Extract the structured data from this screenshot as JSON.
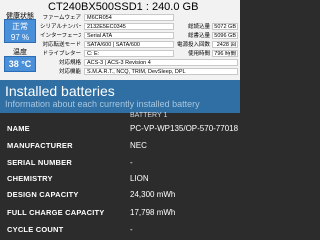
{
  "disk": {
    "title": "CT240BX500SSD1 : 240.0 GB",
    "health_label": "健康状態",
    "health_status": "正常",
    "health_percent": "97 %",
    "temp_label": "温度",
    "temperature": "38 °C",
    "rows": [
      {
        "label": "ファームウェア",
        "value": "M6CR054",
        "label2": "",
        "value2": ""
      },
      {
        "label": "シリアルナンバー",
        "value": "2132E5EC0345",
        "label2": "総読込量",
        "value2": "5072 GB"
      },
      {
        "label": "インターフェース",
        "value": "Serial ATA",
        "label2": "総書込量",
        "value2": "5096 GB"
      },
      {
        "label": "対応転送モード",
        "value": "SATA/600 | SATA/600",
        "label2": "電源投入回数",
        "value2": "2428 回"
      },
      {
        "label": "ドライブレター",
        "value": "C: E:",
        "label2": "使用時間",
        "value2": "796 時間"
      },
      {
        "label": "対応規格",
        "value": "ACS-3 | ACS-3 Revision 4",
        "label2": "",
        "value2": ""
      },
      {
        "label": "対応機能",
        "value": "S.M.A.R.T., NCQ, TRIM, DevSleep, DPL",
        "label2": "",
        "value2": ""
      }
    ]
  },
  "battery_report": {
    "heading": "Installed batteries",
    "subheading": "Information about each currently installed battery",
    "column": "BATTERY 1",
    "rows": [
      {
        "label": "NAME",
        "value": "PC-VP-WP135/OP-570-77018"
      },
      {
        "label": "MANUFACTURER",
        "value": "NEC"
      },
      {
        "label": "SERIAL NUMBER",
        "value": "-"
      },
      {
        "label": "CHEMISTRY",
        "value": "LION"
      },
      {
        "label": "DESIGN CAPACITY",
        "value": "24,300 mWh"
      },
      {
        "label": "FULL CHARGE CAPACITY",
        "value": "17,798 mWh"
      },
      {
        "label": "CYCLE COUNT",
        "value": "-"
      }
    ]
  }
}
